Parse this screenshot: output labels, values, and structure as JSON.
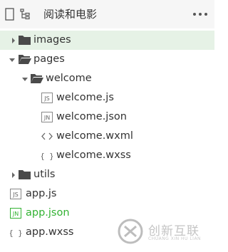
{
  "header": {
    "title": "阅读和电影",
    "icons": {
      "left1": "file-icon",
      "left2": "file-tree-icon",
      "right": "more-icon"
    }
  },
  "tree": {
    "items": [
      {
        "label": "images",
        "type": "folder",
        "expanded": false,
        "selected": true,
        "icon": "folder-icon"
      },
      {
        "label": "pages",
        "type": "folder",
        "expanded": true,
        "icon": "folder-open-icon"
      },
      {
        "label": "welcome",
        "type": "folder",
        "expanded": true,
        "icon": "folder-open-icon"
      },
      {
        "label": "welcome.js",
        "type": "file",
        "badge": "JS",
        "icon": "js-file-icon"
      },
      {
        "label": "welcome.json",
        "type": "file",
        "badge": "JN",
        "icon": "json-file-icon"
      },
      {
        "label": "welcome.wxml",
        "type": "file",
        "badge": "<>",
        "icon": "wxml-file-icon"
      },
      {
        "label": "welcome.wxss",
        "type": "file",
        "badge": "{ }",
        "icon": "wxss-file-icon"
      },
      {
        "label": "utils",
        "type": "folder",
        "expanded": false,
        "icon": "folder-icon"
      },
      {
        "label": "app.js",
        "type": "file",
        "badge": "JS",
        "icon": "js-file-icon"
      },
      {
        "label": "app.json",
        "type": "file",
        "badge": "JN",
        "icon": "json-file-icon",
        "color": "#32b232"
      },
      {
        "label": "app.wxss",
        "type": "file",
        "badge": "{ }",
        "icon": "wxss-file-icon"
      }
    ]
  },
  "watermark": {
    "text": "创新互联",
    "subtext": "CHUANG XIN HU LIAN"
  },
  "colors": {
    "selected_row": "#e6f2e6",
    "accent_green": "#32b232",
    "header_bg": "#f6f6f6"
  }
}
